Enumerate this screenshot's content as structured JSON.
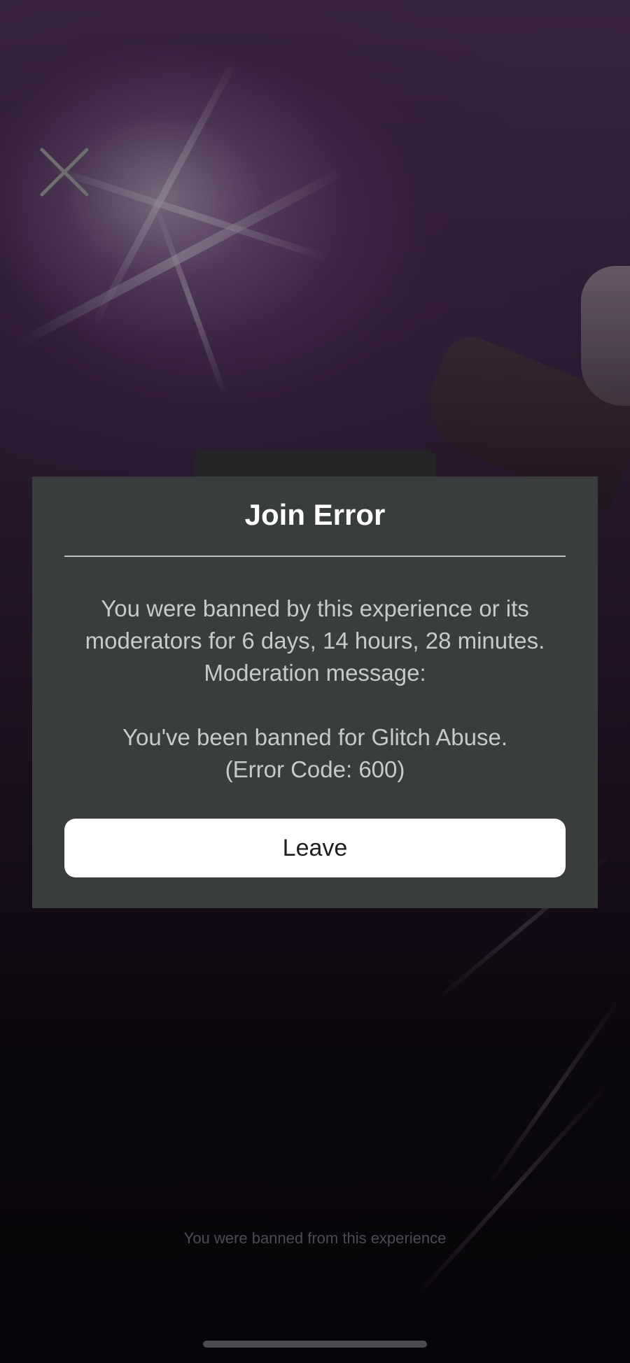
{
  "background": {
    "description_icon": "starburst-background",
    "accent_color": "#4a2f50"
  },
  "close_button": {
    "icon": "close-icon"
  },
  "dialog": {
    "title": "Join Error",
    "message": "You were banned by this experience or its moderators for 6 days, 14 hours, 28 minutes.\nModeration message:\n\nYou've been banned for Glitch Abuse.\n(Error Code: 600)",
    "leave_label": "Leave",
    "background_color": "#393d3e",
    "button_color": "#ffffff"
  },
  "footer": {
    "status_text": "You were banned from this experience"
  }
}
